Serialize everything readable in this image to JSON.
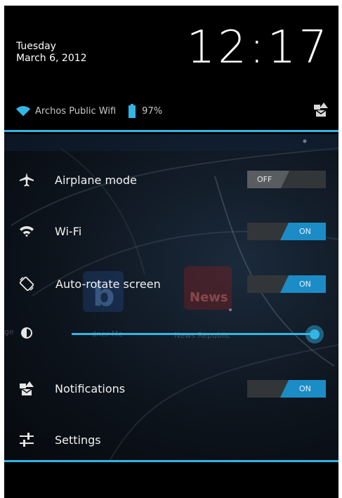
{
  "header": {
    "day": "Tuesday",
    "date": "March 6, 2012",
    "time": "12:17",
    "wifi_name": "Archos Public Wifi",
    "battery": "97%"
  },
  "quick_settings": {
    "airplane": {
      "label": "Airplane mode",
      "state": "OFF"
    },
    "wifi": {
      "label": "Wi-Fi",
      "state": "ON"
    },
    "autorotate": {
      "label": "Auto-rotate screen",
      "state": "ON"
    },
    "brightness": {
      "level": 1.0
    },
    "notifications": {
      "label": "Notifications",
      "state": "ON"
    },
    "settings": {
      "label": "Settings"
    }
  },
  "background_apps": {
    "app1": "dner Me",
    "app2": "News Republic",
    "app2_logo": "News",
    "partial": "ge"
  },
  "colors": {
    "accent": "#33b5e5",
    "toggle_on": "#1c8cc7",
    "background": "#000000"
  }
}
